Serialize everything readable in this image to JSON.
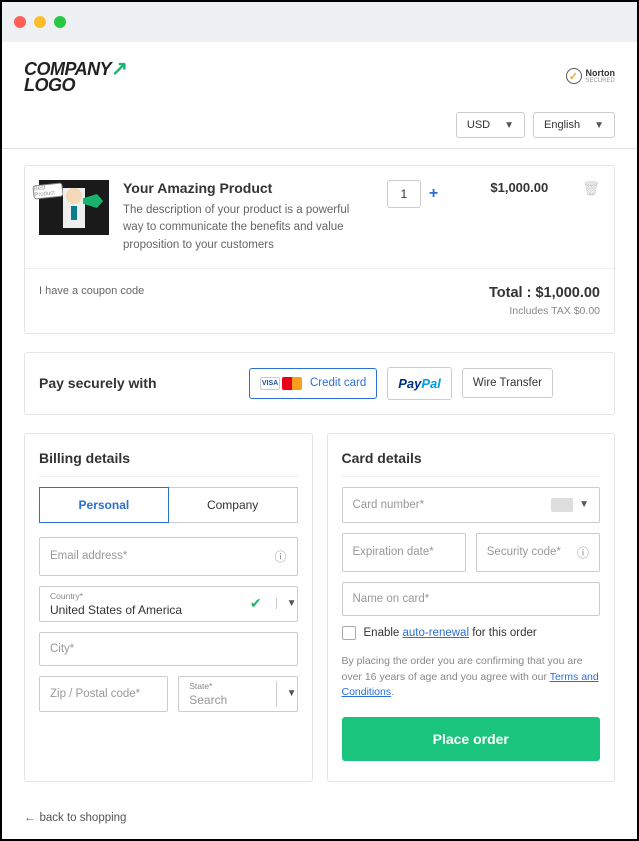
{
  "header": {
    "logo_line1": "COMPANY",
    "logo_line2": "LOGO",
    "badge_name": "Norton",
    "badge_sub": "SECURED"
  },
  "topbar": {
    "currency": "USD",
    "language": "English"
  },
  "product": {
    "title": "Your Amazing Product",
    "description": "The description of your product is a powerful way to communicate the benefits and value proposition to your customers",
    "quantity": "1",
    "price": "$1,000.00",
    "speech": "Best Product"
  },
  "totals": {
    "coupon_text": "I have a coupon code",
    "total_label": "Total : ",
    "total_value": "$1,000.00",
    "tax": "Includes TAX $0.00"
  },
  "pay": {
    "title": "Pay securely with",
    "credit_card": "Credit card",
    "paypal_pay": "Pay",
    "paypal_pal": "Pal",
    "wire": "Wire Transfer"
  },
  "billing": {
    "title": "Billing details",
    "tab_personal": "Personal",
    "tab_company": "Company",
    "email_placeholder": "Email address*",
    "country_label": "Country*",
    "country_value": "United States of America",
    "city_placeholder": "City*",
    "zip_placeholder": "Zip / Postal code*",
    "state_label": "State*",
    "state_value": "Search"
  },
  "carddetails": {
    "title": "Card details",
    "number_placeholder": "Card number*",
    "exp_placeholder": "Expiration date*",
    "cvv_placeholder": "Security code*",
    "name_placeholder": "Name on card*",
    "autorenew_pre": "Enable ",
    "autorenew_link": "auto-renewal",
    "autorenew_post": " for this order",
    "legal_pre": "By placing the order you are confirming that you are over 16 years of age and you agree with our ",
    "legal_link": "Terms and Conditions",
    "legal_post": ".",
    "button": "Place order"
  },
  "footer": {
    "back": "back to shopping"
  }
}
